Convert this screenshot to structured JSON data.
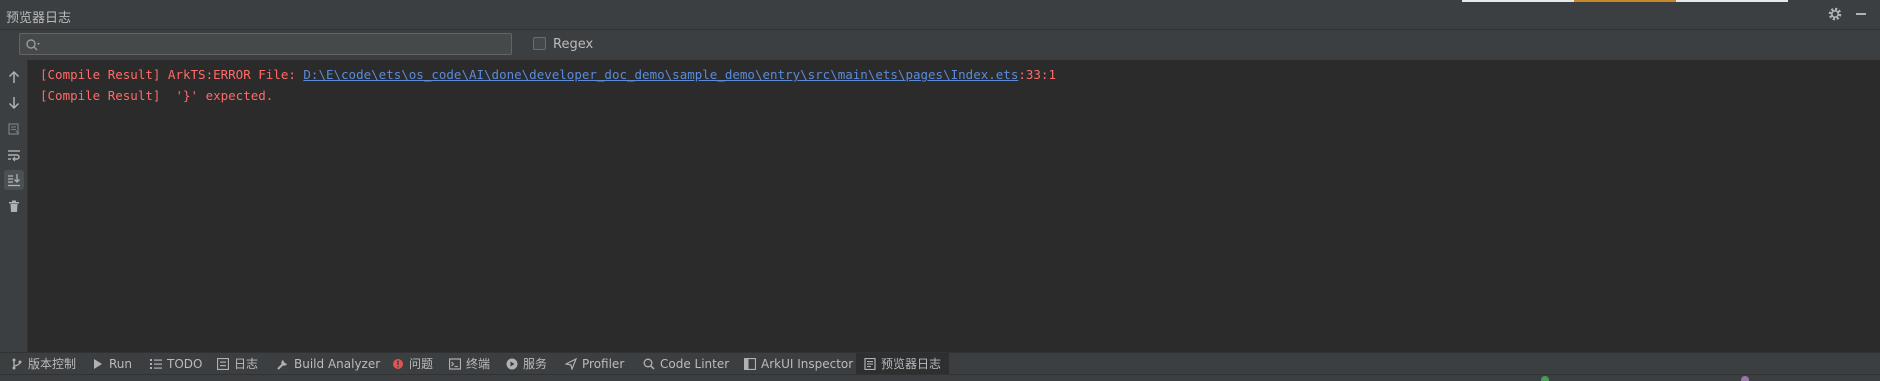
{
  "panel": {
    "title": "预览器日志"
  },
  "search": {
    "value": "",
    "placeholder": "",
    "regex_label": "Regex"
  },
  "console": {
    "line1": {
      "prefix": "[Compile Result] ArkTS:ERROR File: ",
      "path": "D:\\E\\code\\ets\\os_code\\AI\\done\\developer_doc_demo\\sample_demo\\entry\\src\\main\\ets\\pages\\Index.ets",
      "suffix": ":33:1"
    },
    "line2": "[Compile Result]  '}' expected."
  },
  "left_toolbar": [
    {
      "icon": "arrow-up-icon"
    },
    {
      "icon": "arrow-down-icon"
    },
    {
      "icon": "print-icon"
    },
    {
      "icon": "soft-wrap-icon"
    },
    {
      "icon": "scroll-to-end-icon",
      "active": true
    },
    {
      "icon": "trash-icon"
    }
  ],
  "bottom_tabs": [
    {
      "label": "版本控制",
      "icon": "vcs-branch-icon"
    },
    {
      "label": "Run",
      "icon": "run-icon"
    },
    {
      "label": "TODO",
      "icon": "todo-list-icon"
    },
    {
      "label": "日志",
      "icon": "log-icon"
    },
    {
      "label": "Build Analyzer",
      "icon": "build-analyzer-icon"
    },
    {
      "label": "问题",
      "icon": "problems-icon"
    },
    {
      "label": "终端",
      "icon": "terminal-icon"
    },
    {
      "label": "服务",
      "icon": "services-icon"
    },
    {
      "label": "Profiler",
      "icon": "profiler-icon"
    },
    {
      "label": "Code Linter",
      "icon": "code-linter-icon"
    },
    {
      "label": "ArkUI Inspector",
      "icon": "arkui-inspector-icon"
    },
    {
      "label": "预览器日志",
      "icon": "previewer-log-icon",
      "active": true
    }
  ],
  "colors": {
    "background": "#2b2b2b",
    "panel": "#3c3f41",
    "error_text": "#ff6b68",
    "link": "#5b8bd9",
    "problem_badge": "#e05454"
  }
}
